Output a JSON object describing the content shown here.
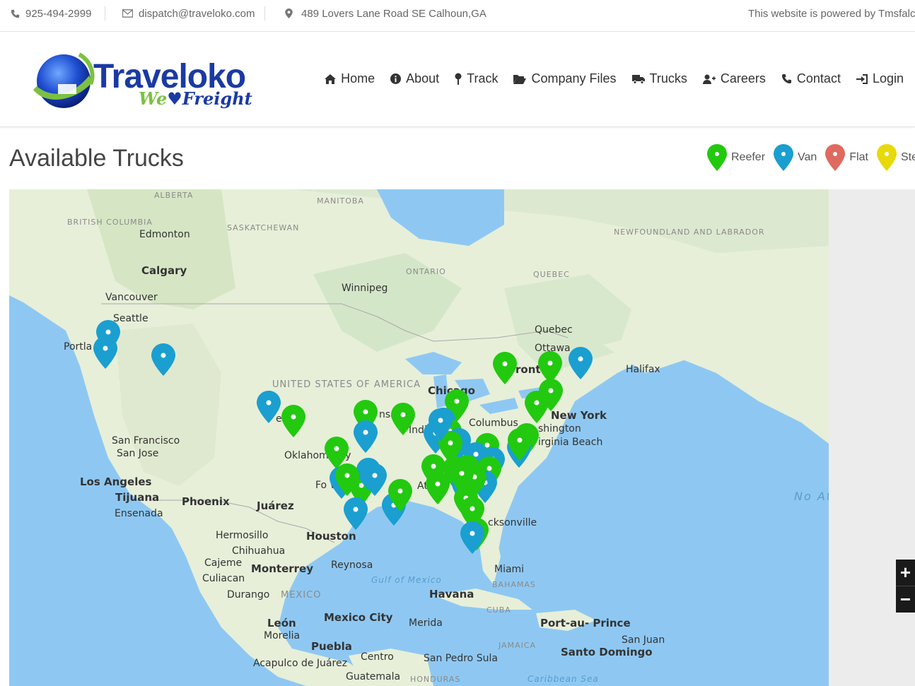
{
  "topbar": {
    "phone": "925-494-2999",
    "email": "dispatch@traveloko.com",
    "address": "489 Lovers Lane Road SE Calhoun,GA",
    "powered": "This website is powered by Tmsfalco"
  },
  "logo": {
    "name": "Traveloko",
    "tagline_we": "We",
    "tagline_freight": "Freight"
  },
  "nav": [
    {
      "label": "Home",
      "icon": "home-icon"
    },
    {
      "label": "About",
      "icon": "info-icon"
    },
    {
      "label": "Track",
      "icon": "map-pin-icon"
    },
    {
      "label": "Company Files",
      "icon": "folder-open-icon"
    },
    {
      "label": "Trucks",
      "icon": "truck-icon"
    },
    {
      "label": "Careers",
      "icon": "user-plus-icon"
    },
    {
      "label": "Contact",
      "icon": "phone-icon"
    },
    {
      "label": "Login",
      "icon": "sign-in-icon"
    }
  ],
  "page_title": "Available Trucks",
  "legend": [
    {
      "label": "Reefer",
      "color": "#22c90f"
    },
    {
      "label": "Van",
      "color": "#1a9fd0"
    },
    {
      "label": "Flat",
      "color": "#e06a5f"
    },
    {
      "label": "Step",
      "color": "#e8d90a"
    }
  ],
  "map": {
    "zoom_in": "+",
    "zoom_out": "−",
    "labels": {
      "alberta": "ALBERTA",
      "manitoba": "MANITOBA",
      "bc": "BRITISH COLUMBIA",
      "saskatchewan": "SASKATCHEWAN",
      "edmonton": "Edmonton",
      "calgary": "Calgary",
      "vancouver": "Vancouver",
      "seattle": "Seattle",
      "portland": "Portla",
      "winnipeg": "Winnipeg",
      "ontario": "ONTARIO",
      "quebec_prov": "QUEBEC",
      "newfoundland": "NEWFOUNDLAND AND LABRADOR",
      "quebec": "Quebec",
      "ottawa": "Ottawa",
      "toronto": "ront",
      "halifax": "Halifax",
      "usa": "UNITED STATES OF AMERICA",
      "chicago": "Chicago",
      "columbus": "Columbus",
      "newyork": "New York",
      "washington": "shington",
      "virginia": "irginia Beach",
      "denver": "enve",
      "kansas": "nsa",
      "indianapolis": "Indi",
      "oklahoma": "Oklahom City",
      "fortworth": "Fo Worth",
      "atlanta": "At",
      "jacksonville": "cksonville",
      "miami": "Miami",
      "sanfrancisco": "San Francisco",
      "sanjose": "San Jose",
      "losangeles": "Los Angeles",
      "tijuana": "Tijuana",
      "ensenada": "Ensenada",
      "phoenix": "Phoenix",
      "juarez": "Juárez",
      "houston": "Houston",
      "hermosillo": "Hermosillo",
      "chihuahua": "Chihuahua",
      "cajeme": "Cajeme",
      "monterrey": "Monterrey",
      "reynosa": "Reynosa",
      "culiacan": "Culiacan",
      "durango": "Durango",
      "mexico": "MEXICO",
      "gulf": "Gulf of Mexico",
      "havana": "Havana",
      "cuba": "CUBA",
      "bahamas": "BAHAMAS",
      "leon": "León",
      "morelia": "Morelia",
      "mexicocity": "Mexico City",
      "puebla": "Puebla",
      "merida": "Merida",
      "acapulco": "Acapulco de Juárez",
      "centro": "Centro",
      "sanpedro": "San Pedro Sula",
      "guatemala": "Guatemala",
      "honduras": "HONDURAS",
      "portauprince": "Port-au- Prince",
      "santodomingo": "Santo Domingo",
      "sanjuan": "San Juan",
      "jamaica": "JAMAICA",
      "caribbean": "Caribbean Sea",
      "atlantic": "No Atlant"
    }
  }
}
